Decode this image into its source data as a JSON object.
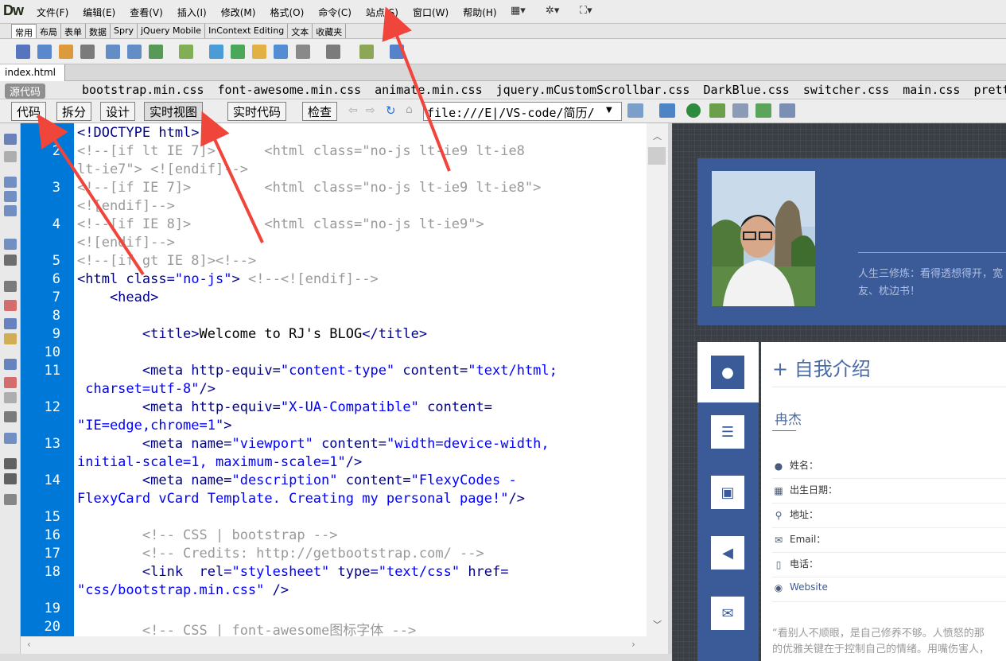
{
  "app": {
    "logo": "Dw"
  },
  "menu": [
    "文件(F)",
    "编辑(E)",
    "查看(V)",
    "插入(I)",
    "修改(M)",
    "格式(O)",
    "命令(C)",
    "站点(S)",
    "窗口(W)",
    "帮助(H)"
  ],
  "insert_tabs": [
    "常用",
    "布局",
    "表单",
    "数据",
    "Spry",
    "jQuery Mobile",
    "InContext Editing",
    "文本",
    "收藏夹"
  ],
  "doc_tab": "index.html",
  "related": {
    "source_label": "源代码",
    "files": [
      "bootstrap.min.css",
      "font-awesome.min.css",
      "animate.min.css",
      "jquery.mCustomScrollbar.css",
      "DarkBlue.css",
      "switcher.css",
      "main.css",
      "pretty"
    ]
  },
  "view_buttons": {
    "code": "代码",
    "split": "拆分",
    "design": "设计",
    "live_view": "实时视图",
    "live_code": "实时代码",
    "inspect": "检查"
  },
  "address": "file:///E|/VS-code/简历/",
  "code_lines": [
    {
      "n": "1",
      "segs": [
        [
          "tag",
          "<!DOCTYPE html>"
        ]
      ]
    },
    {
      "n": "2",
      "segs": [
        [
          "cm",
          "<!--[if lt IE 7]>      <html class=\"no-js lt-ie9 lt-ie8"
        ]
      ]
    },
    {
      "n": "",
      "segs": [
        [
          "cm",
          "lt-ie7\"> <![endif]-->"
        ]
      ]
    },
    {
      "n": "3",
      "segs": [
        [
          "cm",
          "<!--[if IE 7]>         <html class=\"no-js lt-ie9 lt-ie8\">"
        ]
      ]
    },
    {
      "n": "",
      "segs": [
        [
          "cm",
          "<![endif]-->"
        ]
      ]
    },
    {
      "n": "4",
      "segs": [
        [
          "cm",
          "<!--[if IE 8]>         <html class=\"no-js lt-ie9\">"
        ]
      ]
    },
    {
      "n": "",
      "segs": [
        [
          "cm",
          "<![endif]-->"
        ]
      ]
    },
    {
      "n": "5",
      "segs": [
        [
          "cm",
          "<!--[if gt IE 8]><!-->"
        ]
      ]
    },
    {
      "n": "6",
      "segs": [
        [
          "tag",
          "<html "
        ],
        [
          "tag",
          "class="
        ],
        [
          "av",
          "\"no-js\""
        ],
        [
          "tag",
          "> "
        ],
        [
          "cm",
          "<!--<![endif]-->"
        ]
      ]
    },
    {
      "n": "7",
      "segs": [
        [
          "tag",
          "    <head>"
        ]
      ]
    },
    {
      "n": "8",
      "segs": []
    },
    {
      "n": "9",
      "segs": [
        [
          "tag",
          "        <title>"
        ],
        [
          "txt",
          "Welcome to RJ's BLOG"
        ],
        [
          "tag",
          "</title>"
        ]
      ]
    },
    {
      "n": "10",
      "segs": []
    },
    {
      "n": "11",
      "segs": [
        [
          "tag",
          "        <meta http-equiv="
        ],
        [
          "av",
          "\"content-type\""
        ],
        [
          "tag",
          " content="
        ],
        [
          "av",
          "\"text/html;"
        ]
      ]
    },
    {
      "n": "",
      "segs": [
        [
          "av",
          " charset=utf-8\""
        ],
        [
          "tag",
          "/>"
        ]
      ]
    },
    {
      "n": "12",
      "segs": [
        [
          "tag",
          "        <meta http-equiv="
        ],
        [
          "av",
          "\"X-UA-Compatible\""
        ],
        [
          "tag",
          " content="
        ]
      ]
    },
    {
      "n": "",
      "segs": [
        [
          "av",
          "\"IE=edge,chrome=1\""
        ],
        [
          "tag",
          ">"
        ]
      ]
    },
    {
      "n": "13",
      "segs": [
        [
          "tag",
          "        <meta name="
        ],
        [
          "av",
          "\"viewport\""
        ],
        [
          "tag",
          " content="
        ],
        [
          "av",
          "\"width=device-width,"
        ]
      ]
    },
    {
      "n": "",
      "segs": [
        [
          "av",
          "initial-scale=1, maximum-scale=1\""
        ],
        [
          "tag",
          "/>"
        ]
      ]
    },
    {
      "n": "14",
      "segs": [
        [
          "tag",
          "        <meta name="
        ],
        [
          "av",
          "\"description\""
        ],
        [
          "tag",
          " content="
        ],
        [
          "av",
          "\"FlexyCodes -"
        ]
      ]
    },
    {
      "n": "",
      "segs": [
        [
          "av",
          "FlexyCard vCard Template. Creating my personal page!\""
        ],
        [
          "tag",
          "/>"
        ]
      ]
    },
    {
      "n": "15",
      "segs": []
    },
    {
      "n": "16",
      "segs": [
        [
          "cm",
          "        <!-- CSS | bootstrap -->"
        ]
      ]
    },
    {
      "n": "17",
      "segs": [
        [
          "cm",
          "        <!-- Credits: http://getbootstrap.com/ -->"
        ]
      ]
    },
    {
      "n": "18",
      "segs": [
        [
          "tag",
          "        <link  rel="
        ],
        [
          "av",
          "\"stylesheet\""
        ],
        [
          "tag",
          " type="
        ],
        [
          "av",
          "\"text/css\""
        ],
        [
          "tag",
          " href="
        ]
      ]
    },
    {
      "n": "",
      "segs": [
        [
          "av",
          "\"css/bootstrap.min.css\""
        ],
        [
          "tag",
          " />"
        ]
      ]
    },
    {
      "n": "19",
      "segs": []
    },
    {
      "n": "20",
      "segs": [
        [
          "cm",
          "        <!-- CSS | font-awesome图标字体 -->"
        ]
      ]
    }
  ],
  "live": {
    "motto": [
      "人生三修炼：看得透想得开，宽",
      "友、枕边书！"
    ],
    "section_title": "+ 自我介绍",
    "name": "冉杰",
    "info": [
      {
        "icon": "user-icon",
        "label": "姓名："
      },
      {
        "icon": "calendar-icon",
        "label": "出生日期："
      },
      {
        "icon": "map-marker-icon",
        "label": "地址："
      },
      {
        "icon": "envelope-icon",
        "label": "Email："
      },
      {
        "icon": "mobile-icon",
        "label": "电话："
      },
      {
        "icon": "globe-icon",
        "label": "Website"
      }
    ],
    "quote": [
      "“看别人不顺眼，是自己修养不够。人愤怒的那",
      "的优雅关键在于控制自己的情绪。用嘴伤害人，"
    ]
  },
  "colors": {
    "gutter": "#0078d7",
    "header": "#3b5a98",
    "arrow": "#f0453a"
  }
}
